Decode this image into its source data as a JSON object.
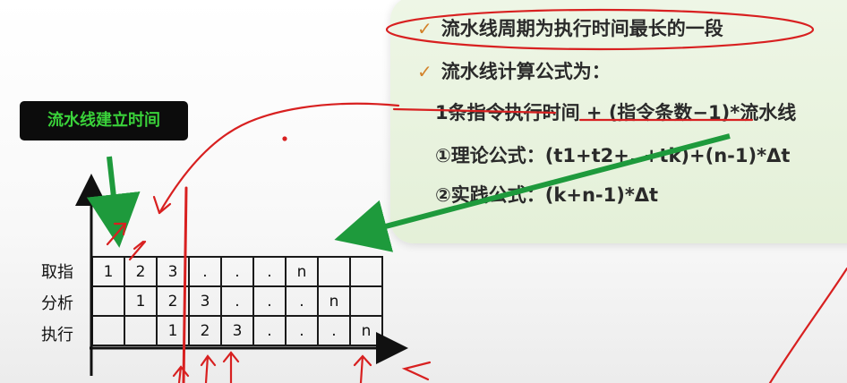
{
  "notes": {
    "line1": "流水线周期为执行时间最长的一段",
    "line2": "流水线计算公式为：",
    "line3": "1条指令执行时间 + (指令条数−1)*流水线",
    "line4": "①理论公式：(t1+t2+..+tk)+(n-1)*Δt",
    "line5": "②实践公式：(k+n-1)*Δt"
  },
  "label": "流水线建立时间",
  "pipeline": {
    "rows": [
      {
        "name": "取指",
        "cells": [
          "1",
          "2",
          "3",
          ".",
          ".",
          ".",
          "n",
          "",
          ""
        ]
      },
      {
        "name": "分析",
        "cells": [
          "",
          "1",
          "2",
          "3",
          ".",
          ".",
          ".",
          "n",
          ""
        ]
      },
      {
        "name": "执行",
        "cells": [
          "",
          "",
          "1",
          "2",
          "3",
          ".",
          ".",
          ".",
          "n"
        ]
      }
    ]
  },
  "colors": {
    "annotation_red": "#d82020",
    "arrow_green": "#1e9a3c",
    "label_text_green": "#3ad23a",
    "check_orange": "#d3822a"
  }
}
